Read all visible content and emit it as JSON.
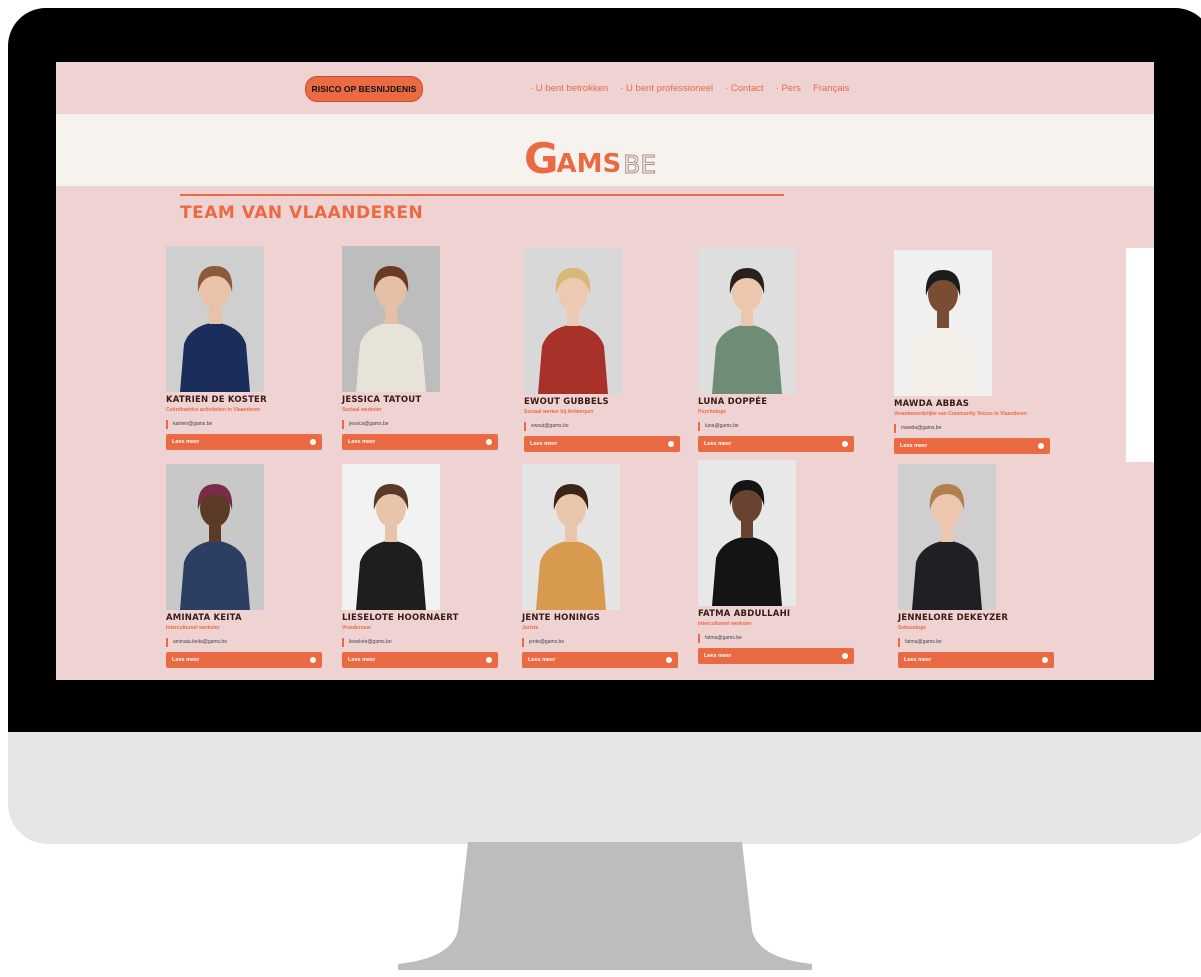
{
  "nav": {
    "cta": "RISICO OP BESNIJDENIS",
    "links": [
      "· U bent betrokken",
      "· U bent professioneel",
      "· Contact",
      "· Pers",
      "Français"
    ]
  },
  "logo": {
    "g": "G",
    "ams": "AMS",
    "be": "BE"
  },
  "section_title": "TEAM VAN VLAANDEREN",
  "button_label": "Lees meer",
  "team": [
    {
      "name": "KATRIEN DE KOSTER",
      "role": "Coördinatrice activiteiten in Vlaanderen",
      "email": "katrien@gams.be",
      "bg": "#cfcfcf",
      "shirt": "#1b2d5a",
      "hair": "#8a5a3a",
      "skin": "#e9c2a8"
    },
    {
      "name": "JESSICA TATOUT",
      "role": "Sociaal werkster",
      "email": "jessica@gams.be",
      "bg": "#bdbdbd",
      "shirt": "#e8e3d8",
      "hair": "#6a3a22",
      "skin": "#e6c0a5"
    },
    {
      "name": "EWOUT GUBBELS",
      "role": "Sociaal werker bij Antwerpen",
      "email": "ewout@gams.be",
      "bg": "#d8d8d8",
      "shirt": "#a8322a",
      "hair": "#d8b878",
      "skin": "#edc9b2"
    },
    {
      "name": "LUNA DOPPÉE",
      "role": "Psychologe",
      "email": "luna@gams.be",
      "bg": "#dedede",
      "shirt": "#6f8d74",
      "hair": "#2b211c",
      "skin": "#ecc6ad"
    },
    {
      "name": "MAWDA ABBAS",
      "role": "Verantwoordelijke van Community Voices in Vlaanderen",
      "email": "mawda@gams.be",
      "bg": "#f0f0f0",
      "shirt": "#f4efe8",
      "hair": "#1c1c1c",
      "skin": "#7a4c32"
    },
    {
      "name": "AMINATA KEITA",
      "role": "Intercultureel werkster",
      "email": "aminata.keita@gams.be",
      "bg": "#c8c8c8",
      "shirt": "#2d3e63",
      "hair": "#7a2a4a",
      "skin": "#5c3a28"
    },
    {
      "name": "LIESELOTE HOORNAERT",
      "role": "Vroedvrouw",
      "email": "lieselote@gams.be",
      "bg": "#f2f2f2",
      "shirt": "#1e1e1e",
      "hair": "#5a3a26",
      "skin": "#e7c4aa"
    },
    {
      "name": "JENTE HONINGS",
      "role": "Juriste",
      "email": "jente@gams.be",
      "bg": "#e4e4e4",
      "shirt": "#d79a4e",
      "hair": "#3a2418",
      "skin": "#e9c5ab"
    },
    {
      "name": "FATMA ABDULLAHI",
      "role": "Intercultureel werkster",
      "email": "fatma@gams.be",
      "bg": "#e8e8e8",
      "shirt": "#141414",
      "hair": "#141414",
      "skin": "#6a4330"
    },
    {
      "name": "JENNELORE DEKEYZER",
      "role": "Seksuologe",
      "email": "fatma@gams.be",
      "bg": "#cfcfcf",
      "shirt": "#1f1f24",
      "hair": "#b0804e",
      "skin": "#ecc6ad"
    }
  ]
}
